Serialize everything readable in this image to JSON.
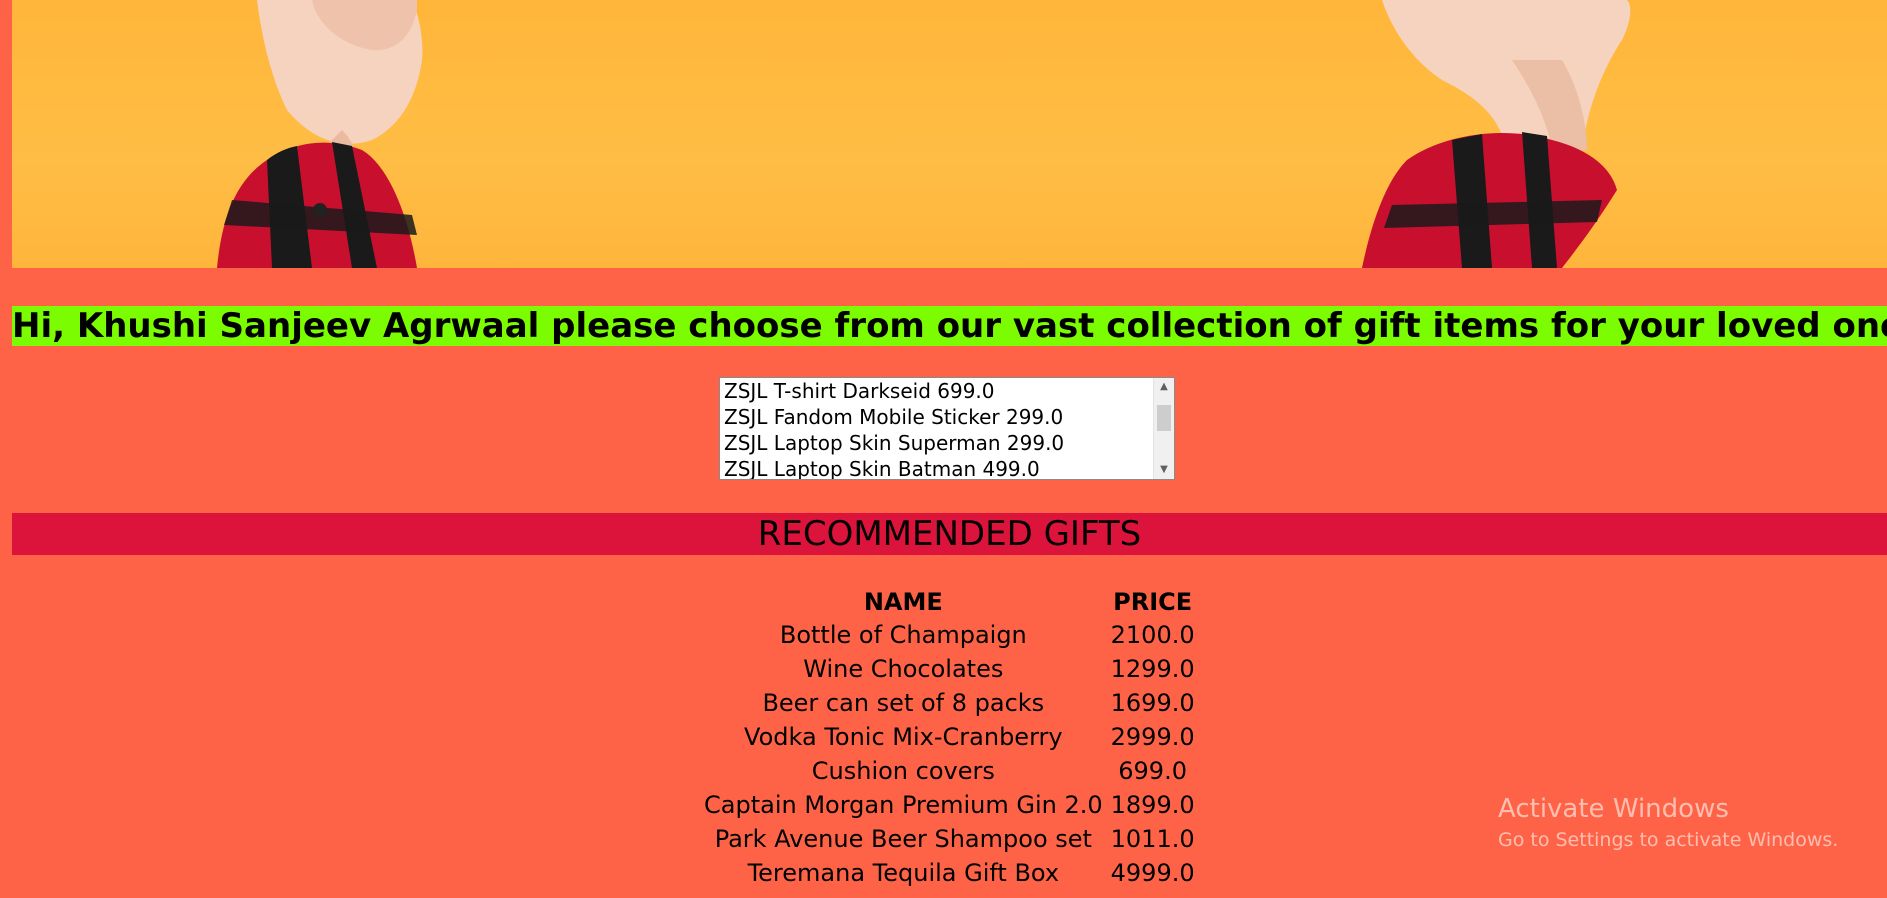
{
  "hero": {
    "background_color": "#ffb83f",
    "sleeve_colors": [
      "#c8102e",
      "#1a1a1a"
    ]
  },
  "greeting": {
    "text": "Hi, Khushi Sanjeev Agrwaal please choose from our vast collection of gift items for your loved ones!",
    "background_color": "#7cfc00"
  },
  "gift_list": {
    "items": [
      "ZSJL T-shirt Darkseid 699.0",
      "ZSJL Fandom Mobile Sticker 299.0",
      "ZSJL Laptop Skin Superman 299.0",
      "ZSJL Laptop Skin Batman 499.0"
    ],
    "scroll_up_icon": "triangle-up-icon",
    "scroll_down_icon": "triangle-down-icon"
  },
  "recommended": {
    "heading": "RECOMMENDED GIFTS",
    "background_color": "#dc143c",
    "columns": [
      "NAME",
      "PRICE"
    ],
    "rows": [
      {
        "name": "Bottle of Champaign",
        "price": "2100.0"
      },
      {
        "name": "Wine Chocolates",
        "price": "1299.0"
      },
      {
        "name": "Beer can set of 8 packs",
        "price": "1699.0"
      },
      {
        "name": "Vodka Tonic Mix-Cranberry",
        "price": "2999.0"
      },
      {
        "name": "Cushion covers",
        "price": "699.0"
      },
      {
        "name": "Captain Morgan Premium Gin 2.0",
        "price": "1899.0"
      },
      {
        "name": "Park Avenue Beer Shampoo set",
        "price": "1011.0"
      },
      {
        "name": "Teremana Tequila Gift Box",
        "price": "4999.0"
      }
    ]
  },
  "watermark": {
    "title": "Activate Windows",
    "subtitle": "Go to Settings to activate Windows."
  },
  "page_background": "#ff6347"
}
